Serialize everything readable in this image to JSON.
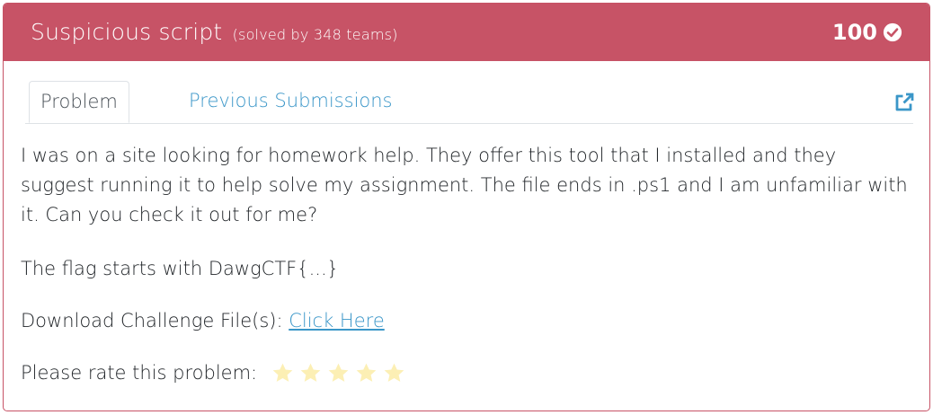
{
  "challenge": {
    "title": "Suspicious script",
    "solved_text": "(solved by 348 teams)",
    "points": "100"
  },
  "tabs": [
    {
      "label": "Problem",
      "active": true
    },
    {
      "label": "Previous Submissions",
      "active": false
    }
  ],
  "description": "I was on a site looking for homework help. They offer this tool that I installed and they suggest running it to help solve my assignment. The file ends in .ps1 and I am unfamiliar with it. Can you check it out for me?",
  "flag_hint": "The flag starts with DawgCTF{...}",
  "download": {
    "label": "Download Challenge File(s): ",
    "link_text": "Click Here"
  },
  "rating": {
    "label": "Please rate this problem:",
    "star_count": 5
  },
  "icons": {
    "solved": "check-circle-icon",
    "open_external": "external-link-icon",
    "rating": "star-icon"
  },
  "colors": {
    "header_bg": "#c75366",
    "link": "#3a96c8",
    "star": "#fcefb4"
  }
}
